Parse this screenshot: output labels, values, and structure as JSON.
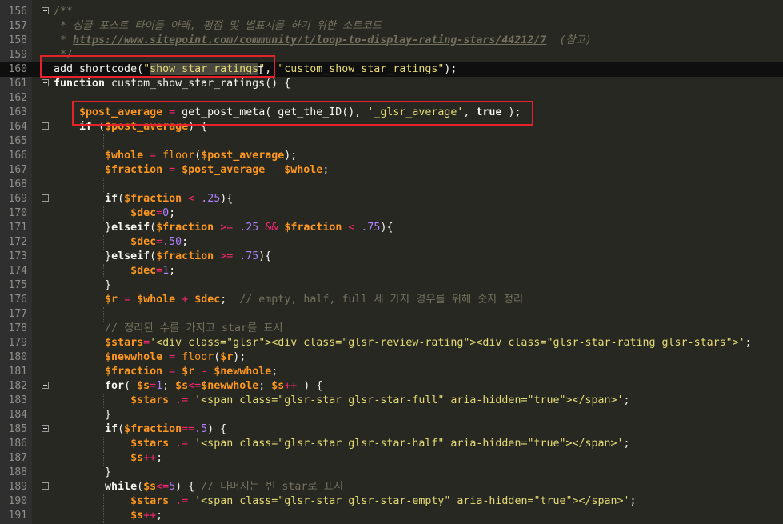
{
  "editor": {
    "theme_colors": {
      "background": "#272822",
      "gutter": "#2f2f2f",
      "current_line": "#0f0f0f",
      "comment": "#75715e",
      "string": "#e6db74",
      "number": "#ae81ff",
      "variable": "#fd971f",
      "operator": "#f92672",
      "highlight_box": "#e8222a"
    },
    "lines": [
      {
        "num": "156",
        "fold": true,
        "guides": [],
        "segs": [
          [
            "c",
            "/**"
          ]
        ]
      },
      {
        "num": "157",
        "fold": false,
        "guides": [],
        "segs": [
          [
            "ci",
            " * "
          ],
          [
            "ci",
            "싱글 포스트 타이틀 아래, 평점 및 별표시를 하기 위한 소트코드"
          ]
        ]
      },
      {
        "num": "158",
        "fold": false,
        "guides": [],
        "segs": [
          [
            "ci",
            " * "
          ],
          [
            "cu",
            "https://www.sitepoint.com/community/t/loop-to-display-rating-stars/44212/7"
          ],
          [
            "ci",
            "  (참고)"
          ]
        ]
      },
      {
        "num": "159",
        "fold": false,
        "guides": [],
        "segs": [
          [
            "c",
            " */"
          ]
        ]
      },
      {
        "num": "160",
        "fold": false,
        "current": true,
        "guides": [],
        "segs": [
          [
            "p",
            "add_shortcode("
          ],
          [
            "s",
            "\""
          ],
          [
            "s sel",
            "show_star_ratings"
          ],
          [
            "s",
            "\""
          ],
          [
            "p",
            ", "
          ],
          [
            "s",
            "\"custom_show_star_ratings\""
          ],
          [
            "p",
            ");"
          ]
        ]
      },
      {
        "num": "161",
        "fold": true,
        "guides": [],
        "segs": [
          [
            "kw",
            "function"
          ],
          [
            "p",
            " custom_show_star_ratings() {"
          ]
        ]
      },
      {
        "num": "162",
        "fold": false,
        "guides": [],
        "segs": []
      },
      {
        "num": "163",
        "fold": false,
        "guides": [
          1
        ],
        "segs": [
          [
            "p",
            "    "
          ],
          [
            "v",
            "$post_average"
          ],
          [
            "p",
            " "
          ],
          [
            "ko",
            "="
          ],
          [
            "p",
            " get_post_meta( get_the_ID(), "
          ],
          [
            "s",
            "'_glsr_average'"
          ],
          [
            "p",
            ", "
          ],
          [
            "kw",
            "true"
          ],
          [
            "p",
            " );"
          ]
        ]
      },
      {
        "num": "164",
        "fold": true,
        "guides": [],
        "segs": [
          [
            "p",
            "    "
          ],
          [
            "kw",
            "if"
          ],
          [
            "p",
            " ("
          ],
          [
            "v",
            "$post_average"
          ],
          [
            "p",
            ") {"
          ]
        ]
      },
      {
        "num": "165",
        "fold": false,
        "guides": [
          1,
          2
        ],
        "segs": []
      },
      {
        "num": "166",
        "fold": false,
        "guides": [
          1
        ],
        "segs": [
          [
            "p",
            "        "
          ],
          [
            "v",
            "$whole"
          ],
          [
            "p",
            " "
          ],
          [
            "ko",
            "="
          ],
          [
            "p",
            " "
          ],
          [
            "f",
            "floor"
          ],
          [
            "p",
            "("
          ],
          [
            "v",
            "$post_average"
          ],
          [
            "p",
            ");"
          ]
        ]
      },
      {
        "num": "167",
        "fold": false,
        "guides": [
          1
        ],
        "segs": [
          [
            "p",
            "        "
          ],
          [
            "v",
            "$fraction"
          ],
          [
            "p",
            " "
          ],
          [
            "ko",
            "="
          ],
          [
            "p",
            " "
          ],
          [
            "v",
            "$post_average"
          ],
          [
            "p",
            " "
          ],
          [
            "ko",
            "-"
          ],
          [
            "p",
            " "
          ],
          [
            "v",
            "$whole"
          ],
          [
            "p",
            ";"
          ]
        ]
      },
      {
        "num": "168",
        "fold": false,
        "guides": [
          1,
          2
        ],
        "segs": []
      },
      {
        "num": "169",
        "fold": true,
        "guides": [
          1
        ],
        "segs": [
          [
            "p",
            "        "
          ],
          [
            "kw",
            "if"
          ],
          [
            "p",
            "("
          ],
          [
            "v",
            "$fraction"
          ],
          [
            "p",
            " "
          ],
          [
            "ko",
            "<"
          ],
          [
            "p",
            " "
          ],
          [
            "n",
            ".25"
          ],
          [
            "p",
            "){"
          ]
        ]
      },
      {
        "num": "170",
        "fold": false,
        "guides": [
          1,
          2
        ],
        "segs": [
          [
            "p",
            "            "
          ],
          [
            "v",
            "$dec"
          ],
          [
            "ko",
            "="
          ],
          [
            "n",
            "0"
          ],
          [
            "p",
            ";"
          ]
        ]
      },
      {
        "num": "171",
        "fold": false,
        "guides": [
          1
        ],
        "segs": [
          [
            "p",
            "        }"
          ],
          [
            "kw",
            "elseif"
          ],
          [
            "p",
            "("
          ],
          [
            "v",
            "$fraction"
          ],
          [
            "p",
            " "
          ],
          [
            "ko",
            ">="
          ],
          [
            "p",
            " "
          ],
          [
            "n",
            ".25"
          ],
          [
            "p",
            " "
          ],
          [
            "ko",
            "&&"
          ],
          [
            "p",
            " "
          ],
          [
            "v",
            "$fraction"
          ],
          [
            "p",
            " "
          ],
          [
            "ko",
            "<"
          ],
          [
            "p",
            " "
          ],
          [
            "n",
            ".75"
          ],
          [
            "p",
            "){"
          ]
        ]
      },
      {
        "num": "172",
        "fold": false,
        "guides": [
          1,
          2
        ],
        "segs": [
          [
            "p",
            "            "
          ],
          [
            "v",
            "$dec"
          ],
          [
            "ko",
            "="
          ],
          [
            "n",
            ".50"
          ],
          [
            "p",
            ";"
          ]
        ]
      },
      {
        "num": "173",
        "fold": false,
        "guides": [
          1
        ],
        "segs": [
          [
            "p",
            "        }"
          ],
          [
            "kw",
            "elseif"
          ],
          [
            "p",
            "("
          ],
          [
            "v",
            "$fraction"
          ],
          [
            "p",
            " "
          ],
          [
            "ko",
            ">="
          ],
          [
            "p",
            " "
          ],
          [
            "n",
            ".75"
          ],
          [
            "p",
            "){"
          ]
        ]
      },
      {
        "num": "174",
        "fold": false,
        "guides": [
          1,
          2
        ],
        "segs": [
          [
            "p",
            "            "
          ],
          [
            "v",
            "$dec"
          ],
          [
            "ko",
            "="
          ],
          [
            "n",
            "1"
          ],
          [
            "p",
            ";"
          ]
        ]
      },
      {
        "num": "175",
        "fold": false,
        "guides": [
          1
        ],
        "segs": [
          [
            "p",
            "        }"
          ]
        ]
      },
      {
        "num": "176",
        "fold": false,
        "guides": [
          1
        ],
        "segs": [
          [
            "p",
            "        "
          ],
          [
            "v",
            "$r"
          ],
          [
            "p",
            " "
          ],
          [
            "ko",
            "="
          ],
          [
            "p",
            " "
          ],
          [
            "v",
            "$whole"
          ],
          [
            "p",
            " "
          ],
          [
            "ko",
            "+"
          ],
          [
            "p",
            " "
          ],
          [
            "v",
            "$dec"
          ],
          [
            "p",
            ";  "
          ],
          [
            "c",
            "// empty, half, full 세 가지 경우를 위해 숫자 정리"
          ]
        ]
      },
      {
        "num": "177",
        "fold": false,
        "guides": [
          1,
          2
        ],
        "segs": []
      },
      {
        "num": "178",
        "fold": false,
        "guides": [
          1
        ],
        "segs": [
          [
            "p",
            "        "
          ],
          [
            "c",
            "// 정리된 수를 가지고 star를 표시"
          ]
        ]
      },
      {
        "num": "179",
        "fold": false,
        "guides": [
          1
        ],
        "segs": [
          [
            "p",
            "        "
          ],
          [
            "v",
            "$stars"
          ],
          [
            "ko",
            "="
          ],
          [
            "s",
            "'<div class=\"glsr\"><div class=\"glsr-review-rating\"><div class=\"glsr-star-rating glsr-stars\">'"
          ],
          [
            "p",
            ";"
          ]
        ]
      },
      {
        "num": "180",
        "fold": false,
        "guides": [
          1
        ],
        "segs": [
          [
            "p",
            "        "
          ],
          [
            "v",
            "$newwhole"
          ],
          [
            "p",
            " "
          ],
          [
            "ko",
            "="
          ],
          [
            "p",
            " "
          ],
          [
            "f",
            "floor"
          ],
          [
            "p",
            "("
          ],
          [
            "v",
            "$r"
          ],
          [
            "p",
            ");"
          ]
        ]
      },
      {
        "num": "181",
        "fold": false,
        "guides": [
          1
        ],
        "segs": [
          [
            "p",
            "        "
          ],
          [
            "v",
            "$fraction"
          ],
          [
            "p",
            " "
          ],
          [
            "ko",
            "="
          ],
          [
            "p",
            " "
          ],
          [
            "v",
            "$r"
          ],
          [
            "p",
            " "
          ],
          [
            "ko",
            "-"
          ],
          [
            "p",
            " "
          ],
          [
            "v",
            "$newwhole"
          ],
          [
            "p",
            ";"
          ]
        ]
      },
      {
        "num": "182",
        "fold": true,
        "guides": [
          1
        ],
        "segs": [
          [
            "p",
            "        "
          ],
          [
            "kw",
            "for"
          ],
          [
            "p",
            "( "
          ],
          [
            "v",
            "$s"
          ],
          [
            "ko",
            "="
          ],
          [
            "n",
            "1"
          ],
          [
            "p",
            "; "
          ],
          [
            "v",
            "$s"
          ],
          [
            "ko",
            "<="
          ],
          [
            "v",
            "$newwhole"
          ],
          [
            "p",
            "; "
          ],
          [
            "v",
            "$s"
          ],
          [
            "ko",
            "++"
          ],
          [
            "p",
            " ) {"
          ]
        ]
      },
      {
        "num": "183",
        "fold": false,
        "guides": [
          1,
          2
        ],
        "segs": [
          [
            "p",
            "            "
          ],
          [
            "v",
            "$stars"
          ],
          [
            "p",
            " "
          ],
          [
            "ko",
            ".="
          ],
          [
            "p",
            " "
          ],
          [
            "s",
            "'<span class=\"glsr-star glsr-star-full\" aria-hidden=\"true\"></span>'"
          ],
          [
            "p",
            ";"
          ]
        ]
      },
      {
        "num": "184",
        "fold": false,
        "guides": [
          1
        ],
        "segs": [
          [
            "p",
            "        }"
          ]
        ]
      },
      {
        "num": "185",
        "fold": true,
        "guides": [
          1
        ],
        "segs": [
          [
            "p",
            "        "
          ],
          [
            "kw",
            "if"
          ],
          [
            "p",
            "("
          ],
          [
            "v",
            "$fraction"
          ],
          [
            "ko",
            "=="
          ],
          [
            "n",
            ".5"
          ],
          [
            "p",
            ") {"
          ]
        ]
      },
      {
        "num": "186",
        "fold": false,
        "guides": [
          1,
          2
        ],
        "segs": [
          [
            "p",
            "            "
          ],
          [
            "v",
            "$stars"
          ],
          [
            "p",
            " "
          ],
          [
            "ko",
            ".="
          ],
          [
            "p",
            " "
          ],
          [
            "s",
            "'<span class=\"glsr-star glsr-star-half\" aria-hidden=\"true\"></span>'"
          ],
          [
            "p",
            ";"
          ]
        ]
      },
      {
        "num": "187",
        "fold": false,
        "guides": [
          1,
          2
        ],
        "segs": [
          [
            "p",
            "            "
          ],
          [
            "v",
            "$s"
          ],
          [
            "ko",
            "++"
          ],
          [
            "p",
            ";"
          ]
        ]
      },
      {
        "num": "188",
        "fold": false,
        "guides": [
          1
        ],
        "segs": [
          [
            "p",
            "        }"
          ]
        ]
      },
      {
        "num": "189",
        "fold": true,
        "guides": [
          1
        ],
        "segs": [
          [
            "p",
            "        "
          ],
          [
            "kw",
            "while"
          ],
          [
            "p",
            "("
          ],
          [
            "v",
            "$s"
          ],
          [
            "ko",
            "<="
          ],
          [
            "n",
            "5"
          ],
          [
            "p",
            ") { "
          ],
          [
            "c",
            "// 나머지는 빈 star로 표시"
          ]
        ]
      },
      {
        "num": "190",
        "fold": false,
        "guides": [
          1,
          2
        ],
        "segs": [
          [
            "p",
            "            "
          ],
          [
            "v",
            "$stars"
          ],
          [
            "p",
            " "
          ],
          [
            "ko",
            ".="
          ],
          [
            "p",
            " "
          ],
          [
            "s",
            "'<span class=\"glsr-star glsr-star-empty\" aria-hidden=\"true\"></span>'"
          ],
          [
            "p",
            ";"
          ]
        ]
      },
      {
        "num": "191",
        "fold": false,
        "guides": [
          1,
          2
        ],
        "segs": [
          [
            "p",
            "            "
          ],
          [
            "v",
            "$s"
          ],
          [
            "ko",
            "++"
          ],
          [
            "p",
            ";"
          ]
        ]
      }
    ]
  }
}
